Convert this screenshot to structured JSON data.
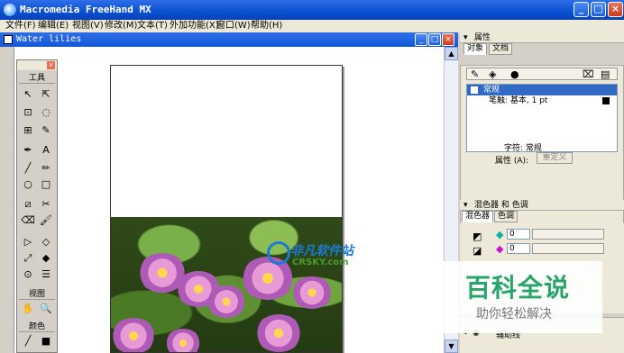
{
  "app": {
    "title": "Macromedia FreeHand MX",
    "icon": "freehand-icon"
  },
  "window_buttons": {
    "minimize": "_",
    "maximize": "□",
    "close": "×"
  },
  "menu": [
    "文件(F)",
    "编辑(E)",
    "视图(V)",
    "修改(M)",
    "文本(T)",
    "外加功能(X)",
    "窗口(W)",
    "帮助(H)"
  ],
  "document": {
    "title": "Water lilies"
  },
  "toolbox": {
    "sections": {
      "tools": "工具",
      "view": "视图",
      "colors": "颜色"
    }
  },
  "properties": {
    "panel_title": "属性",
    "tabs": [
      "对象",
      "文档"
    ],
    "items": [
      "常规",
      "笔触: 基本, 1 pt"
    ],
    "font_label": "字符: 常规",
    "attr_label": "属性 (A):",
    "attr_button": "重定义"
  },
  "mixer": {
    "panel_title": "混色器 和 色调",
    "tabs": [
      "混色器",
      "色调"
    ],
    "values": [
      "0",
      "0"
    ]
  },
  "layers": {
    "item": "辅助线"
  },
  "watermarks": {
    "big": "百科全说",
    "big_sub": "助你轻松解决",
    "small": "非凡软件站",
    "small_sub": "CRSKY.com"
  },
  "colors": {
    "titlebar": "#0a4fd1",
    "selection": "#316ac5",
    "watermark_green": "#2aa56a"
  }
}
